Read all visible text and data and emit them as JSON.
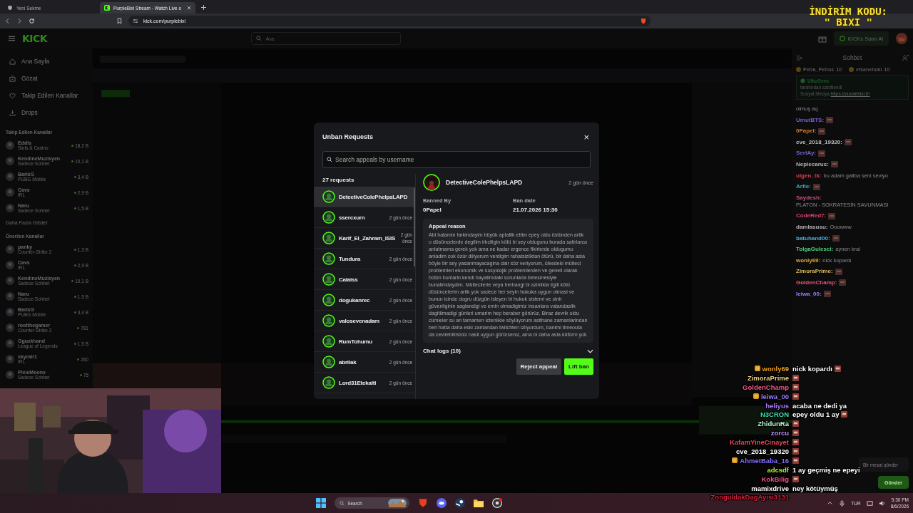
{
  "browser": {
    "tabs": [
      {
        "title": "Yeni Sekme",
        "selected": false
      },
      {
        "title": "PurpleBixi Stream - Watch Live o",
        "selected": true
      }
    ],
    "url": "kick.com/purplebixi"
  },
  "promo": [
    "İNDİRİM KODU:",
    "\" BIXI \""
  ],
  "site": {
    "logo": "KICK",
    "search": {
      "placeholder": "Ara"
    },
    "buy_button": "KICKs Satın Al"
  },
  "sidebar": {
    "nav": [
      {
        "label": "Ana Sayfa"
      },
      {
        "label": "Gözat"
      },
      {
        "label": "Takip Edilen Kanallar"
      },
      {
        "label": "Drops"
      }
    ],
    "followed_title": "Takip Edilen Kanallar",
    "followed": [
      {
        "name": "Eddis",
        "category": "Slots & Casino",
        "viewers": "18,2 B"
      },
      {
        "name": "KendineMuzisyen",
        "category": "Sadece Sohbet",
        "viewers": "10,1 B"
      },
      {
        "name": "BarisG",
        "category": "PUBG Mobile",
        "viewers": "3,4 B"
      },
      {
        "name": "Cavs",
        "category": "IRL",
        "viewers": "2,9 B"
      },
      {
        "name": "Naru",
        "category": "Sadece Sohbet",
        "viewers": "1,5 B"
      }
    ],
    "show_more": "Daha Fazla Göster",
    "recommended_title": "Önerilen Kanallar",
    "recommended": [
      {
        "name": "panky",
        "category": "Counter-Strike 2",
        "viewers": "1,3 B"
      },
      {
        "name": "Cavs",
        "category": "IRL",
        "viewers": "2,9 B"
      },
      {
        "name": "KendineMuzisyen",
        "category": "Sadece Sohbet",
        "viewers": "10,1 B"
      },
      {
        "name": "Naru",
        "category": "Sadece Sohbet",
        "viewers": "1,5 B"
      },
      {
        "name": "BarisG",
        "category": "PUBG Mobile",
        "viewers": "3,4 B"
      },
      {
        "name": "rootthegamer",
        "category": "Counter-Strike 2",
        "viewers": "781"
      },
      {
        "name": "Oguzkhand",
        "category": "League of Legends",
        "viewers": "1,5 B"
      },
      {
        "name": "skyrair1",
        "category": "IRL",
        "viewers": "260"
      },
      {
        "name": "PixieMoonx",
        "category": "Sadece Sohbet",
        "viewers": "75"
      }
    ]
  },
  "modal": {
    "title": "Unban Requests",
    "close": "×",
    "search": {
      "placeholder": "Search appeals by username"
    },
    "count": "27 requests",
    "requests": [
      {
        "name": "DetectiveColePhelpsLAPD",
        "selected": true
      },
      {
        "name": "ssercxurn",
        "time": "2 gün önce",
        "selected": false
      },
      {
        "name": "Karif_El_Zahram_ISIS",
        "time": "2 gün önce",
        "selected": false
      },
      {
        "name": "Tundura",
        "time": "2 gün önce",
        "selected": false
      },
      {
        "name": "Calaiss",
        "time": "2 gün önce",
        "selected": false
      },
      {
        "name": "dogukanrec",
        "time": "2 gün önce",
        "selected": false
      },
      {
        "name": "valosevenadam",
        "time": "2 gün önce",
        "selected": false
      },
      {
        "name": "RumTohumu",
        "time": "2 gün önce",
        "selected": false
      },
      {
        "name": "abrilak",
        "time": "2 gün önce",
        "selected": false
      },
      {
        "name": "Lord31Etekalti",
        "time": "2 gün önce",
        "selected": false
      }
    ],
    "detail": {
      "name": "DetectiveColePhelpsLAPD",
      "time": "2 gün önce",
      "banned_by_label": "Banned By",
      "banned_by": "0Papel",
      "ban_date_label": "Ban date",
      "ban_date": "21.07.2026 15:30",
      "appeal_title": "Appeal reason",
      "appeal": "Abi hatamin farkindayim büyük aptallik ettim epey oldu üstünden artik o düsüncelerde degilim irkciligin kötü bi sey oldugunu burada satirlarca anlatmama gerek yok ama ne kadar ergence fikirlerde oldugumu anladim cok özür diliyorum verdigim rahatsizliktan ötürü, bir daha asla böyle bir sey yasanmayacagina dair söz veriyorum, ülkedeki mülteci problemleri ekonomik ve sosyolojik problemlerden ve genell olarak bütün bunlarin kendi hayatimdaki sorunlarla birlesmesiyle bunalimdaydim. Mültecilerle veya herhangi bi azinlikla ilgili kötü düsüncelerim artik yok sadece her seyin hukuka uygun olmasi ve bunun icinde dogru düzgün isleyen bi hukuk sistemi ve sinir güvenliginin saglandigi ve emin olmadigimiz insanlara vatandaslik dagitilmadigi günleri umarim hep beraber görürüz. Biraz devrik oldu cümleler su an tamamen ictenlikle söylüyorum asithane zamanlarindan beri hatta daha eski zamandan twitchten izliyordum, banimi timeouta da cevirebilirsiniz nasil uygun görürseniz, ama bi daha asla küfürm yok",
      "chat_logs": "Chat logs (10)",
      "chat_logs_expanded": false
    },
    "buttons": [
      {
        "label": "Reject appeal",
        "kind": "secondary"
      },
      {
        "label": "Lift ban",
        "kind": "primary"
      }
    ]
  },
  "chat": {
    "title": "Sohbet",
    "gifters": [
      {
        "name": "Petra_Petrus",
        "count": "10"
      },
      {
        "name": "efsanehoki",
        "count": "10"
      }
    ],
    "pinned": {
      "author": "UlkuGenc",
      "note": "tarafından sabitlendi",
      "label": "Sosyal Medya:",
      "link": "https://purplebixi.tr/"
    },
    "messages": [
      {
        "text": "olmuş aq"
      },
      {
        "name": "UmutBTS:",
        "color": "#7a5fd0",
        "emote": true
      },
      {
        "name": "0Papel:",
        "color": "#c87a30",
        "emote": true
      },
      {
        "name": "cve_2018_19320:",
        "color": "#bdbdbd",
        "emote": true
      },
      {
        "name": "SertAy:",
        "color": "#7a5fd0",
        "emote": true
      },
      {
        "name": "Neplecarus:",
        "color": "#b0b0b0",
        "emote": true
      },
      {
        "name": "ulgen_tk:",
        "color": "#d04050",
        "text": "bu adam galiba seni seviyo"
      },
      {
        "name": "Arfie:",
        "color": "#3fa7c5",
        "emote": true
      },
      {
        "name": "Saydesh:",
        "color": "#c05080",
        "text": "PLATON - SOKRATESİN SAVUNMASI"
      },
      {
        "name": "CodeRed7:",
        "color": "#e04070",
        "emote": true
      },
      {
        "name": "damlasusu:",
        "color": "#b0b0b0",
        "text": "Ooowww"
      },
      {
        "name": "batuhand00:",
        "color": "#4aaae0",
        "emote": true
      },
      {
        "name": "TolgaGulesci:",
        "color": "#4fce7a",
        "text": "aynen kral"
      },
      {
        "name": "wonly69:",
        "color": "#e0a63a",
        "text": "nick kopardı"
      },
      {
        "name": "ZimoraPrime:",
        "color": "#d6b85c",
        "emote": true
      },
      {
        "name": "GoldenChamp:",
        "color": "#e0557e",
        "emote": true
      },
      {
        "name": "leiwa_00:",
        "color": "#9a7fff",
        "emote": true
      }
    ],
    "input": {
      "placeholder": "Bir mesaj gönder"
    },
    "send": "Gönder"
  },
  "overlay_chat": [
    {
      "name": "wonly69",
      "color": "#f0a020",
      "badge": true,
      "text": "nick kopardı",
      "emote": true
    },
    {
      "name": "ZimoraPrime",
      "color": "#f0d080",
      "badge": false,
      "emote": true
    },
    {
      "name": "GoldenChamp",
      "color": "#f05a8a",
      "badge": false,
      "emote": true
    },
    {
      "name": "leiwa_00",
      "color": "#9a7cff",
      "badge": true,
      "emote": true
    },
    {
      "name": "heliyus",
      "color": "#a879ff",
      "badge": false,
      "text": "acaba ne dedi ya",
      "emote": false
    },
    {
      "name": "N3CRON",
      "color": "#3fe0b0",
      "badge": false,
      "text": "epey oldu 1 ay",
      "emote": true
    },
    {
      "name": "ZhidunRa",
      "color": "#b8f5d0",
      "badge": false,
      "emote": true
    },
    {
      "name": "zorcu",
      "color": "#b98cff",
      "badge": false,
      "emote": true
    },
    {
      "name": "KafamYineCinayet",
      "color": "#ee4658",
      "badge": false,
      "emote": true
    },
    {
      "name": "cve_2018_19320",
      "color": "#ffffff",
      "badge": false,
      "emote": true
    },
    {
      "name": "AhmetBaba_16",
      "color": "#8a6cff",
      "badge": true,
      "emote": true
    },
    {
      "name": "adcsdf",
      "color": "#b6f03a",
      "badge": false,
      "text": "1 ay geçmiş ne epeyi",
      "emote": false
    },
    {
      "name": "KokBilig",
      "color": "#f0508a",
      "badge": false,
      "emote": true
    },
    {
      "name": "mamixdrive",
      "color": "#ffffff",
      "badge": false,
      "text": "ney kötüymüş",
      "emote": false
    },
    {
      "name": "ZonguldakDagAyisi3131",
      "color": "#d0243c",
      "badge": false,
      "emote": false
    }
  ],
  "taskbar": {
    "search": {
      "placeholder": "Search"
    },
    "language": "TUR",
    "time": "5:30 PM",
    "date": "8/6/2026"
  }
}
